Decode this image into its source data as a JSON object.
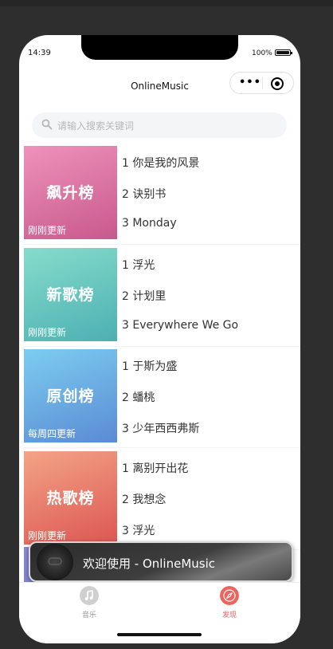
{
  "status": {
    "time": "14:39",
    "battery": "100%"
  },
  "nav": {
    "title": "OnlineMusic"
  },
  "capsule": {
    "more_icon": "more-dots-icon",
    "close_icon": "target-circle-icon"
  },
  "search": {
    "placeholder": "请输入搜索关键词",
    "value": ""
  },
  "charts": [
    {
      "cover_title": "飙升榜",
      "update": "刚刚更新",
      "colors": [
        "#e98bb3",
        "#c55a8e"
      ],
      "songs": [
        "1 你是我的风景",
        "2 诀别书",
        "3 Monday"
      ]
    },
    {
      "cover_title": "新歌榜",
      "update": "刚刚更新",
      "colors": [
        "#7fd8c6",
        "#4db2b5"
      ],
      "songs": [
        "1 浮光",
        "2 计划里",
        "3 Everywhere We Go"
      ]
    },
    {
      "cover_title": "原创榜",
      "update": "每周四更新",
      "colors": [
        "#7cc9ee",
        "#5d8fd6"
      ],
      "songs": [
        "1 于斯为盛",
        "2 蟠桃",
        "3 少年西西弗斯"
      ]
    },
    {
      "cover_title": "热歌榜",
      "update": "刚刚更新",
      "colors": [
        "#f2a083",
        "#df5b55"
      ],
      "songs": [
        "1 离别开出花",
        "2 我想念",
        "3 浮光"
      ]
    }
  ],
  "toast": {
    "text": "欢迎使用 - OnlineMusic"
  },
  "tabbar": {
    "tabs": [
      {
        "label": "音乐",
        "icon": "music-note-icon",
        "color": "#999999"
      },
      {
        "label": "发现",
        "icon": "compass-icon",
        "color": "#f0625c"
      }
    ]
  }
}
